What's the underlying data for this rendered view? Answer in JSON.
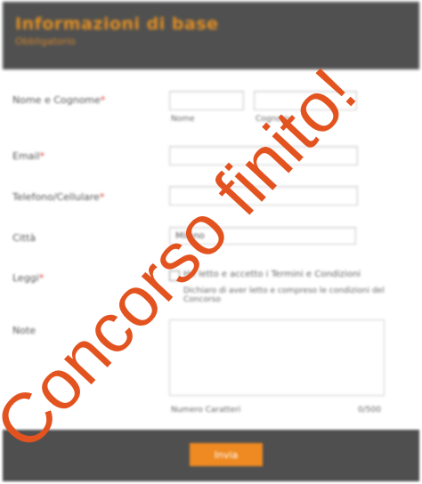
{
  "header": {
    "title": "Informazioni di base",
    "subtitle": "Obbligatorio"
  },
  "form": {
    "name_label": "Nome e Cognome",
    "first_sub": "Nome",
    "last_sub": "Cognome",
    "email_label": "Email",
    "phone_label": "Telefono/Cellulare",
    "city_label": "Città",
    "city_value": "Milano",
    "terms_label": "Leggi",
    "terms_text": "Ho letto e accetto i Termini e Condizioni",
    "terms_subtext": "Dichiaro di aver letto e compreso le condizioni del Concorso",
    "notes_label": "Note",
    "char_label": "Numero Caratteri",
    "char_count": "0/500"
  },
  "footer": {
    "submit_label": "Invia"
  },
  "overlay": {
    "text": "Concorso finito!",
    "color": "#e2531f"
  }
}
